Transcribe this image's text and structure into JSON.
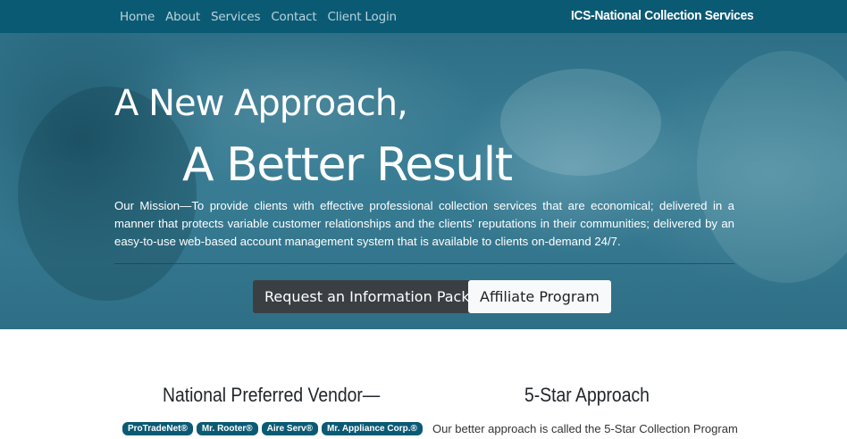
{
  "nav": {
    "links": [
      "Home",
      "About",
      "Services",
      "Contact",
      "Client Login"
    ],
    "brand": "ICS-National Collection Services"
  },
  "hero": {
    "title_line1": "A New Approach,",
    "title_line2": "A Better Result",
    "mission": "Our Mission—To provide clients with effective professional collection services that are economical; delivered in a manner that protects variable customer relationships and the clients' reputations in their communities; delivered by an easy-to-use web-based account management system that is available to clients on-demand 24/7.",
    "primary_button": "Request an Information Packet",
    "secondary_button": "Affiliate Program"
  },
  "vendor": {
    "title": "National Preferred Vendor—",
    "badges": [
      "ProTradeNet®",
      "Mr. Rooter®",
      "Aire Serv®",
      "Mr. Appliance Corp.®"
    ]
  },
  "five_star": {
    "title": "5-Star Approach",
    "text": "Our better approach is called the 5-Star Collection Program"
  },
  "colors": {
    "nav_bg": "#0b5a74",
    "badge_bg": "#0b5a74",
    "dark_button": "#3a3f44"
  }
}
